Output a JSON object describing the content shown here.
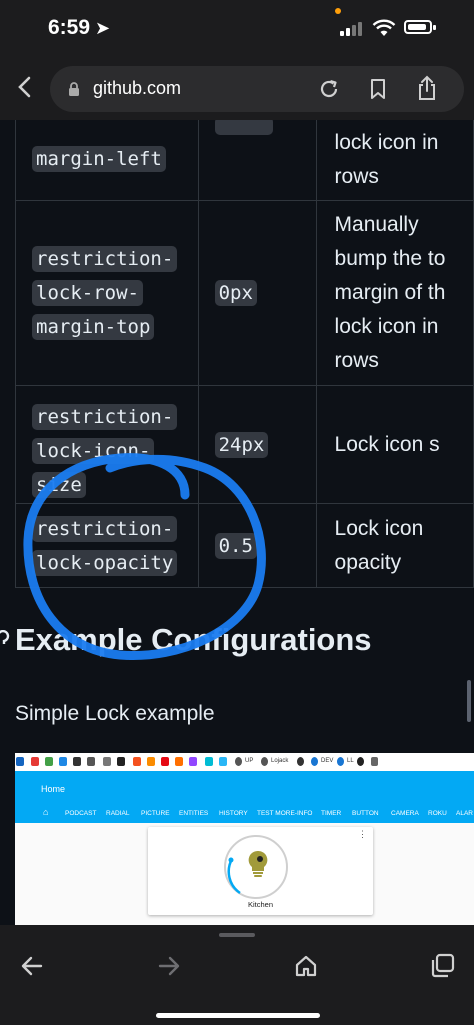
{
  "status_bar": {
    "time": "6:59"
  },
  "browser": {
    "url": "github.com"
  },
  "table": {
    "rows": [
      {
        "name_lines": [
          "margin-left"
        ],
        "value": "",
        "desc_lines": [
          "lock icon in",
          "rows"
        ]
      },
      {
        "name_lines": [
          "restriction-",
          "lock-row-",
          "margin-top"
        ],
        "value": "0px",
        "desc_lines": [
          "Manually",
          "bump the to",
          "margin of th",
          "lock icon in",
          "rows"
        ]
      },
      {
        "name_lines": [
          "restriction-",
          "lock-icon-",
          "size"
        ],
        "value": "24px",
        "desc_lines": [
          "Lock icon s"
        ]
      },
      {
        "name_lines": [
          "restriction-",
          "lock-opacity"
        ],
        "value": "0.5",
        "desc_lines": [
          "Lock icon",
          "opacity"
        ]
      }
    ]
  },
  "section": {
    "heading": "Example Configurations",
    "subheading": "Simple Lock example"
  },
  "screenshot": {
    "bookmarks": [
      "UP",
      "Lojack",
      "DEV",
      "LL"
    ],
    "home_title": "Home",
    "tabs": [
      "PODCAST",
      "RADIAL",
      "PICTURE",
      "ENTITIES",
      "HISTORY",
      "TEST MORE-INFO",
      "TIMER",
      "BUTTON",
      "CAMERA",
      "ROKU",
      "ALAR"
    ],
    "card_label": "Kitchen"
  },
  "colors": {
    "page_bg": "#0d1117",
    "chrome_bg": "#1c1c1e",
    "annotation_blue": "#1a7cf0",
    "ha_header": "#03a9f4",
    "bulb": "#a19a3a"
  }
}
